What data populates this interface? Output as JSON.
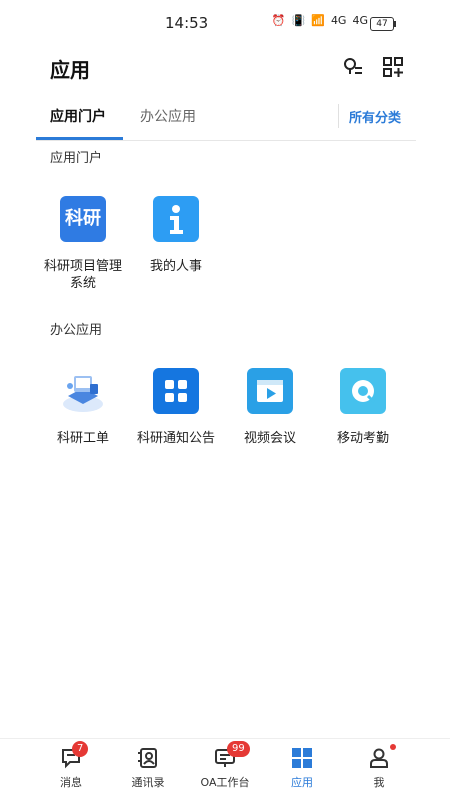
{
  "status_bar": {
    "time": "14:53",
    "signal_1": "4G",
    "signal_2": "4G",
    "battery": "47"
  },
  "header": {
    "title": "应用",
    "icons": [
      "search-list-icon",
      "qr-add-icon"
    ]
  },
  "tabs": {
    "items": [
      {
        "label": "应用门户",
        "active": true
      },
      {
        "label": "办公应用",
        "active": false
      }
    ],
    "all_categories": "所有分类"
  },
  "sections": [
    {
      "title": "应用门户",
      "apps": [
        {
          "label": "科研项目管理系统",
          "icon_text": "科研"
        },
        {
          "label": "我的人事",
          "icon_text": "i"
        }
      ]
    },
    {
      "title": "办公应用",
      "apps": [
        {
          "label": "科研工单"
        },
        {
          "label": "科研通知公告"
        },
        {
          "label": "视频会议"
        },
        {
          "label": "移动考勤"
        }
      ]
    }
  ],
  "bottom_nav": {
    "items": [
      {
        "label": "消息",
        "badge": "7"
      },
      {
        "label": "通讯录"
      },
      {
        "label": "OA工作台",
        "badge": "99"
      },
      {
        "label": "应用",
        "active": true
      },
      {
        "label": "我",
        "dot": true
      }
    ]
  },
  "colors": {
    "accent": "#2b7bd8",
    "badge": "#e53935"
  }
}
